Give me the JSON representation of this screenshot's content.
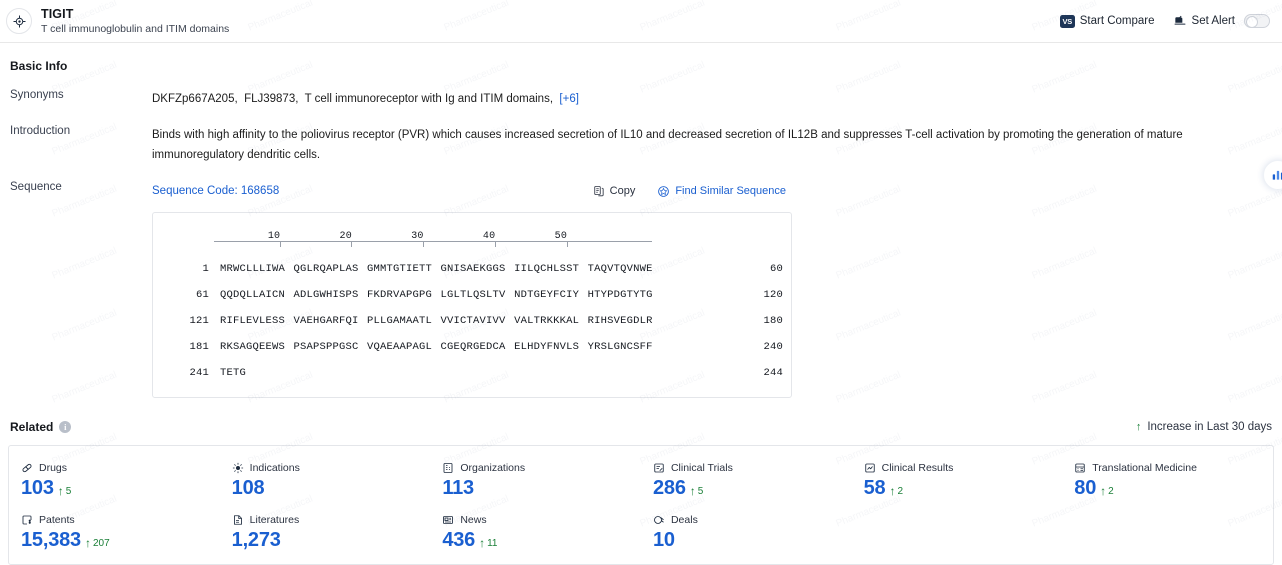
{
  "header": {
    "title": "TIGIT",
    "subtitle": "T cell immunoglobulin and ITIM domains",
    "target_icon": "target-crosshair-icon",
    "compare_label": "Start Compare",
    "compare_icon": "vs-icon",
    "compare_icon_text": "VS",
    "alert_label": "Set Alert",
    "alert_icon": "bell-alert-icon",
    "alert_toggle_state": "off"
  },
  "basic_info": {
    "section_title": "Basic Info",
    "synonyms_label": "Synonyms",
    "synonyms": [
      "DKFZp667A205,",
      "FLJ39873,",
      "T cell immunoreceptor with Ig and ITIM domains,"
    ],
    "synonyms_more": "[+6]",
    "introduction_label": "Introduction",
    "introduction": "Binds with high affinity to the poliovirus receptor (PVR) which causes increased secretion of IL10 and decreased secretion of IL12B and suppresses T-cell activation by promoting the generation of mature immunoregulatory dendritic cells."
  },
  "sequence": {
    "label": "Sequence",
    "code_label": "Sequence Code: 168658",
    "copy_label": "Copy",
    "copy_icon": "copy-icon",
    "find_label": "Find Similar Sequence",
    "find_icon": "find-similar-icon",
    "ruler_ticks": [
      "10",
      "20",
      "30",
      "40",
      "50"
    ],
    "rows": [
      {
        "start": "1",
        "chunks": [
          "MRWCLLLIWA",
          "QGLRQAPLAS",
          "GMMTGTIETT",
          "GNISAEKGGS",
          "IILQCHLSST",
          "TAQVTQVNWE"
        ],
        "end": "60"
      },
      {
        "start": "61",
        "chunks": [
          "QQDQLLAICN",
          "ADLGWHISPS",
          "FKDRVAPGPG",
          "LGLTLQSLTV",
          "NDTGEYFCIY",
          "HTYPDGTYTG"
        ],
        "end": "120"
      },
      {
        "start": "121",
        "chunks": [
          "RIFLEVLESS",
          "VAEHGARFQI",
          "PLLGAMAATL",
          "VVICTAVIVV",
          "VALTRKKKAL",
          "RIHSVEGDLR"
        ],
        "end": "180"
      },
      {
        "start": "181",
        "chunks": [
          "RKSAGQEEWS",
          "PSAPSPPGSC",
          "VQAEAAPAGL",
          "CGEQRGEDCA",
          "ELHDYFNVLS",
          "YRSLGNCSFF"
        ],
        "end": "240"
      },
      {
        "start": "241",
        "chunks": [
          "TETG"
        ],
        "end": "244"
      }
    ]
  },
  "related": {
    "section_title": "Related",
    "info_icon": "info-icon",
    "legend_label": "Increase in Last 30 days",
    "legend_icon": "arrow-up-icon",
    "cards": [
      {
        "label": "Drugs",
        "icon": "capsule-icon",
        "value": "103",
        "delta": "5"
      },
      {
        "label": "Indications",
        "icon": "virus-icon",
        "value": "108",
        "delta": ""
      },
      {
        "label": "Organizations",
        "icon": "building-icon",
        "value": "113",
        "delta": ""
      },
      {
        "label": "Clinical Trials",
        "icon": "clipboard-icon",
        "value": "286",
        "delta": "5"
      },
      {
        "label": "Clinical Results",
        "icon": "chart-doc-icon",
        "value": "58",
        "delta": "2"
      },
      {
        "label": "Translational Medicine",
        "icon": "lab-doc-icon",
        "value": "80",
        "delta": "2"
      },
      {
        "label": "Patents",
        "icon": "patent-icon",
        "value": "15,383",
        "delta": "207"
      },
      {
        "label": "Literatures",
        "icon": "literature-icon",
        "value": "1,273",
        "delta": ""
      },
      {
        "label": "News",
        "icon": "news-icon",
        "value": "436",
        "delta": "11"
      },
      {
        "label": "Deals",
        "icon": "handshake-icon",
        "value": "10",
        "delta": ""
      }
    ]
  },
  "float_button": {
    "icon": "bar-chart-icon"
  },
  "colors": {
    "accent_blue": "#1a5fd0",
    "delta_green": "#1a7f37",
    "dark_navy": "#1d3557",
    "border": "#e4e6ea"
  }
}
